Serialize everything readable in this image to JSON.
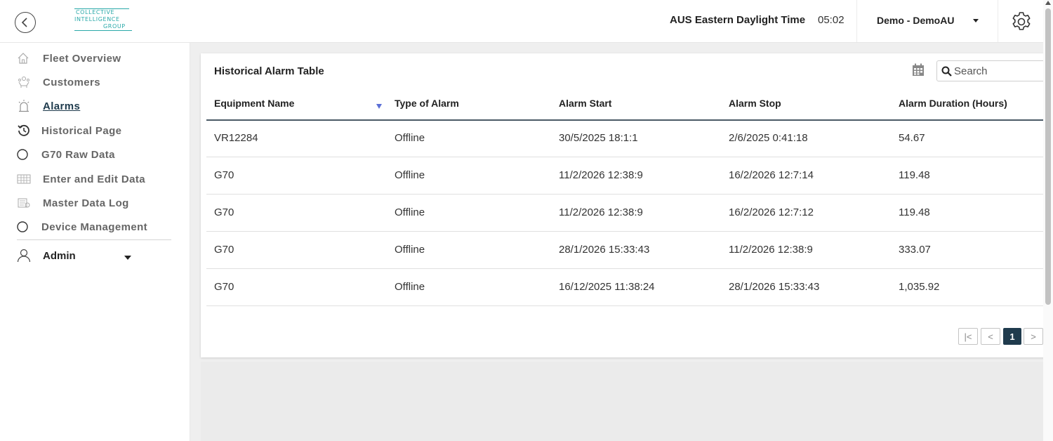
{
  "header": {
    "logo_line1": "COLLECTIVE",
    "logo_line2": "INTELLIGENCE",
    "logo_line3": "GROUP",
    "timezone_label": "AUS Eastern Daylight Time",
    "time": "05:02",
    "account_label": "Demo - DemoAU"
  },
  "sidebar": {
    "items": [
      {
        "label": "Fleet Overview",
        "icon": "home-icon"
      },
      {
        "label": "Customers",
        "icon": "customers-icon"
      },
      {
        "label": "Alarms",
        "icon": "alarm-icon",
        "active": true
      },
      {
        "label": "Historical Page",
        "icon": "history-icon"
      },
      {
        "label": "G70 Raw Data",
        "icon": "circle-icon"
      },
      {
        "label": "Enter and Edit Data",
        "icon": "table-icon"
      },
      {
        "label": "Master Data Log",
        "icon": "data-log-icon"
      },
      {
        "label": "Device Management",
        "icon": "circle-icon"
      }
    ],
    "user_label": "Admin"
  },
  "table": {
    "title": "Historical Alarm Table",
    "search_placeholder": "Search",
    "columns": [
      "Equipment Name",
      "Type of Alarm",
      "Alarm Start",
      "Alarm Stop",
      "Alarm Duration (Hours)"
    ],
    "sorted_column": "Equipment Name",
    "rows": [
      [
        "VR12284",
        "Offline",
        "30/5/2025 18:1:1",
        "2/6/2025 0:41:18",
        "54.67"
      ],
      [
        "G70",
        "Offline",
        "11/2/2026 12:38:9",
        "16/2/2026 12:7:14",
        "119.48"
      ],
      [
        "G70",
        "Offline",
        "11/2/2026 12:38:9",
        "16/2/2026 12:7:12",
        "119.48"
      ],
      [
        "G70",
        "Offline",
        "28/1/2026 15:33:43",
        "11/2/2026 12:38:9",
        "333.07"
      ],
      [
        "G70",
        "Offline",
        "16/12/2025 11:38:24",
        "28/1/2026 15:33:43",
        "1,035.92"
      ]
    ]
  },
  "pagination": {
    "first": "|<",
    "prev": "<",
    "current_page": "1",
    "next": ">"
  },
  "colors": {
    "accent": "#1f3b4d",
    "logo": "#2aa9a9",
    "sort_indicator": "#5b6fd6"
  }
}
